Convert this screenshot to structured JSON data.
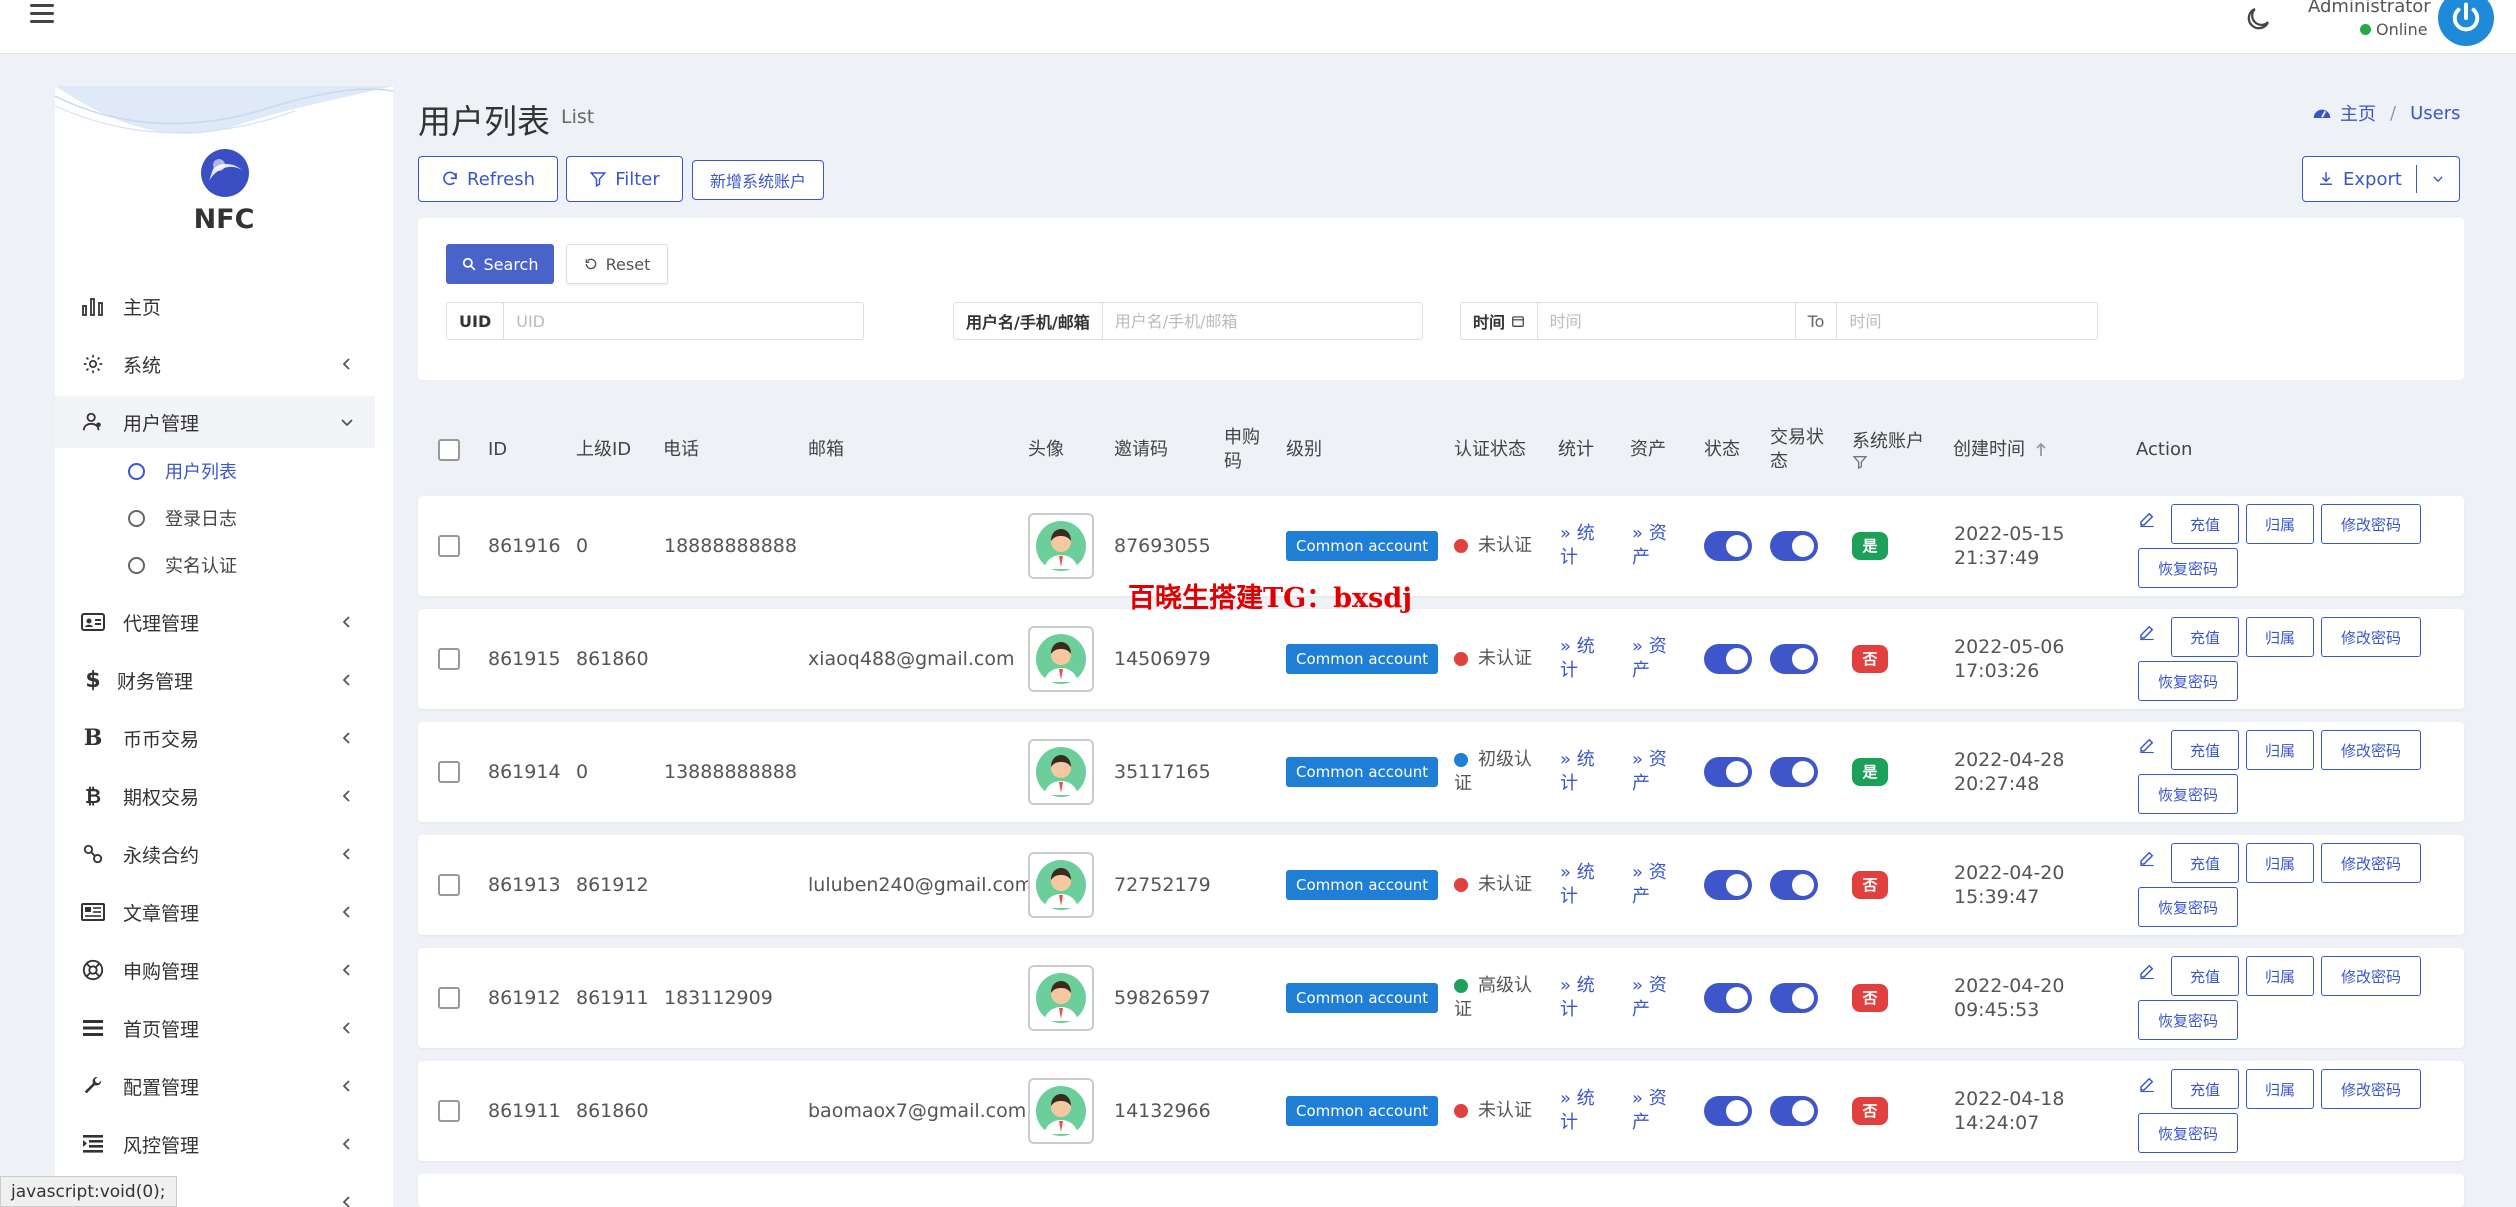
{
  "header": {
    "admin_name": "Administrator",
    "status": "Online"
  },
  "sidebar": {
    "brand": "NFC",
    "items": [
      {
        "label": "主页"
      },
      {
        "label": "系统"
      },
      {
        "label": "用户管理"
      },
      {
        "label": "代理管理"
      },
      {
        "label": "财务管理"
      },
      {
        "label": "币币交易"
      },
      {
        "label": "期权交易"
      },
      {
        "label": "永续合约"
      },
      {
        "label": "文章管理"
      },
      {
        "label": "申购管理"
      },
      {
        "label": "首页管理"
      },
      {
        "label": "配置管理"
      },
      {
        "label": "风控管理"
      }
    ],
    "sub_items": [
      {
        "label": "用户列表"
      },
      {
        "label": "登录日志"
      },
      {
        "label": "实名认证"
      }
    ]
  },
  "page": {
    "title": "用户列表",
    "subtitle": "List",
    "breadcrumb_home": "主页",
    "breadcrumb_current": "Users"
  },
  "toolbar": {
    "refresh": "Refresh",
    "filter": "Filter",
    "add_system": "新增系统账户",
    "export": "Export"
  },
  "filters": {
    "search": "Search",
    "reset": "Reset",
    "uid_label": "UID",
    "uid_placeholder": "UID",
    "user_label": "用户名/手机/邮箱",
    "user_placeholder": "用户名/手机/邮箱",
    "time_label": "时间",
    "time_placeholder_from": "时间",
    "to_label": "To",
    "time_placeholder_to": "时间"
  },
  "table": {
    "headers": {
      "id": "ID",
      "parent": "上级ID",
      "phone": "电话",
      "email": "邮箱",
      "avatar": "头像",
      "invite": "邀请码",
      "subscribe_1": "申购",
      "subscribe_2": "码",
      "level": "级别",
      "auth": "认证状态",
      "stats": "统计",
      "assets": "资产",
      "status": "状态",
      "trade_1": "交易状",
      "trade_2": "态",
      "sysacct": "系统账户",
      "created": "创建时间",
      "action": "Action"
    },
    "rows": [
      {
        "id": "861916",
        "parent": "0",
        "phone": "18888888888",
        "email": "",
        "invite": "87693055",
        "level": "Common account",
        "auth_1": "未认证",
        "auth_2": "",
        "auth_color": "#e23f3f",
        "stats_1": "» 统",
        "stats_2": "计",
        "assets_1": "» 资",
        "assets_2": "产",
        "sys": "是",
        "sys_yes": true,
        "date": "2022-05-15",
        "time": "21:37:49"
      },
      {
        "id": "861915",
        "parent": "861860",
        "phone": "",
        "email": "xiaoq488@gmail.com",
        "invite": "14506979",
        "level": "Common account",
        "auth_1": "未认证",
        "auth_2": "",
        "auth_color": "#e23f3f",
        "stats_1": "» 统",
        "stats_2": "计",
        "assets_1": "» 资",
        "assets_2": "产",
        "sys": "否",
        "sys_yes": false,
        "date": "2022-05-06",
        "time": "17:03:26"
      },
      {
        "id": "861914",
        "parent": "0",
        "phone": "13888888888",
        "email": "",
        "invite": "35117165",
        "level": "Common account",
        "auth_1": "初级认",
        "auth_2": "证",
        "auth_color": "#1f7fd6",
        "stats_1": "» 统",
        "stats_2": "计",
        "assets_1": "» 资",
        "assets_2": "产",
        "sys": "是",
        "sys_yes": true,
        "date": "2022-04-28",
        "time": "20:27:48"
      },
      {
        "id": "861913",
        "parent": "861912",
        "phone": "",
        "email": "luluben240@gmail.com",
        "invite": "72752179",
        "level": "Common account",
        "auth_1": "未认证",
        "auth_2": "",
        "auth_color": "#e23f3f",
        "stats_1": "» 统",
        "stats_2": "计",
        "assets_1": "» 资",
        "assets_2": "产",
        "sys": "否",
        "sys_yes": false,
        "date": "2022-04-20",
        "time": "15:39:47"
      },
      {
        "id": "861912",
        "parent": "861911",
        "phone": "183112909",
        "email": "",
        "invite": "59826597",
        "level": "Common account",
        "auth_1": "高级认",
        "auth_2": "证",
        "auth_color": "#1da05a",
        "stats_1": "» 统",
        "stats_2": "计",
        "assets_1": "» 资",
        "assets_2": "产",
        "sys": "否",
        "sys_yes": false,
        "date": "2022-04-20",
        "time": "09:45:53"
      },
      {
        "id": "861911",
        "parent": "861860",
        "phone": "",
        "email": "baomaox7@gmail.com",
        "invite": "14132966",
        "level": "Common account",
        "auth_1": "未认证",
        "auth_2": "",
        "auth_color": "#e23f3f",
        "stats_1": "» 统",
        "stats_2": "计",
        "assets_1": "» 资",
        "assets_2": "产",
        "sys": "否",
        "sys_yes": false,
        "date": "2022-04-18",
        "time": "14:24:07"
      }
    ],
    "actions": {
      "recharge": "充值",
      "belong": "归属",
      "change_pwd": "修改密码",
      "restore_pwd": "恢复密码"
    }
  },
  "watermark": "百晓生搭建TG：bxsdj",
  "statusbar": "javascript:void(0);"
}
